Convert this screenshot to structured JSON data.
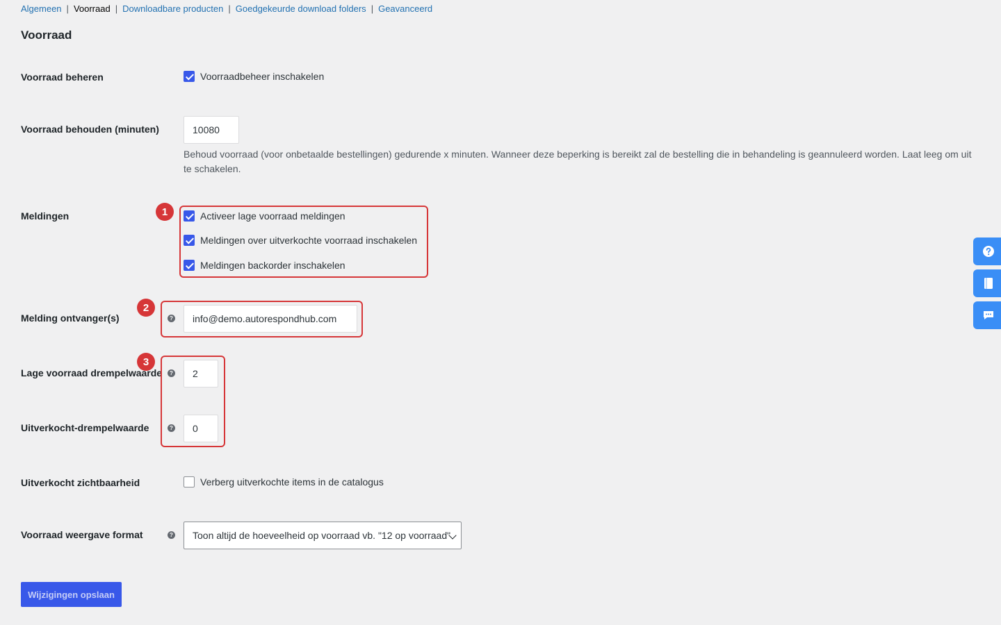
{
  "subnav": {
    "items": [
      "Algemeen",
      "Voorraad",
      "Downloadbare producten",
      "Goedgekeurde download folders",
      "Geavanceerd"
    ],
    "separator": "|",
    "current_index": 1
  },
  "section_title": "Voorraad",
  "fields": {
    "manage_stock": {
      "label": "Voorraad beheren",
      "checkbox_label": "Voorraadbeheer inschakelen",
      "checked": true
    },
    "hold_stock": {
      "label": "Voorraad behouden (minuten)",
      "value": "10080",
      "description": "Behoud voorraad (voor onbetaalde bestellingen) gedurende x minuten. Wanneer deze beperking is bereikt zal de bestelling die in behandeling is geannuleerd worden. Laat leeg om uit te schakelen."
    },
    "notifications": {
      "label": "Meldingen",
      "options": [
        {
          "label": "Activeer lage voorraad meldingen",
          "checked": true
        },
        {
          "label": "Meldingen over uitverkochte voorraad inschakelen",
          "checked": true
        },
        {
          "label": "Meldingen backorder inschakelen",
          "checked": true
        }
      ]
    },
    "notification_recipient": {
      "label": "Melding ontvanger(s)",
      "value": "info@demo.autorespondhub.com"
    },
    "low_stock_threshold": {
      "label": "Lage voorraad drempelwaarde",
      "value": "2"
    },
    "out_of_stock_threshold": {
      "label": "Uitverkocht-drempelwaarde",
      "value": "0"
    },
    "out_of_stock_visibility": {
      "label": "Uitverkocht zichtbaarheid",
      "checkbox_label": "Verberg uitverkochte items in de catalogus",
      "checked": false
    },
    "stock_display_format": {
      "label": "Voorraad weergave format",
      "selected": "Toon altijd de hoeveelheid op voorraad vb. \"12 op voorraad\""
    }
  },
  "help_tip_glyph": "?",
  "save_button": "Wijzigingen opslaan",
  "annotations": [
    "1",
    "2",
    "3"
  ],
  "colors": {
    "accent": "#3858e9",
    "link": "#2271b1",
    "highlight": "#d63638",
    "side_buttons": "#3a8ef6"
  },
  "side_buttons": [
    "help-icon",
    "book-icon",
    "chat-icon"
  ]
}
